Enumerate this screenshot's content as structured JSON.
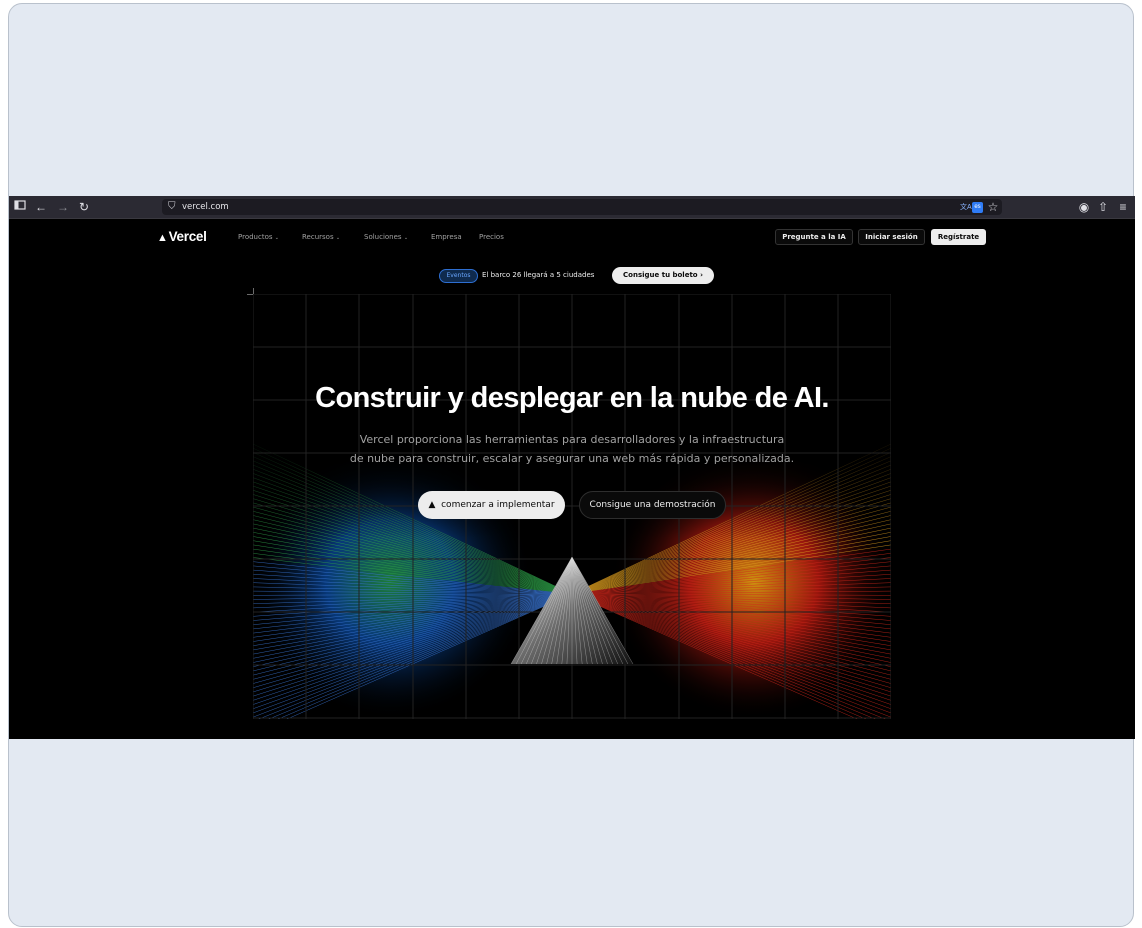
{
  "browser": {
    "url": "vercel.com",
    "icons": [
      "sidebar-icon",
      "back-icon",
      "forward-icon",
      "reload-icon",
      "shield-icon",
      "translate-icon",
      "bookmark-star-icon",
      "account-icon",
      "extensions-icon",
      "menu-icon"
    ],
    "translate_badge": "es"
  },
  "site": {
    "logo": "Vercel",
    "nav": [
      "Productos",
      "Recursos",
      "Soluciones",
      "Empresa",
      "Precios"
    ],
    "ask_ai": "Pregunte a la IA",
    "login": "Iniciar sesión",
    "signup": "Regístrate"
  },
  "announcement": {
    "badge": "Eventos",
    "text": "El barco 26 llegará a 5 ciudades",
    "cta": "Consigue tu boleto"
  },
  "hero": {
    "title": "Construir y desplegar en la nube de AI.",
    "subtitle_line1": "Vercel proporciona las herramientas para desarrolladores y la infraestructura",
    "subtitle_line2": "de nube para construir, escalar y asegurar una web más rápida y personalizada.",
    "cta_primary": "comenzar a implementar",
    "cta_secondary": "Consigue una demostración"
  },
  "colors": {
    "frame_bg": "#e3e9f2",
    "toolbar_bg": "#2b2a33",
    "page_bg": "#000000",
    "accent_blue": "#2d6ed1"
  }
}
